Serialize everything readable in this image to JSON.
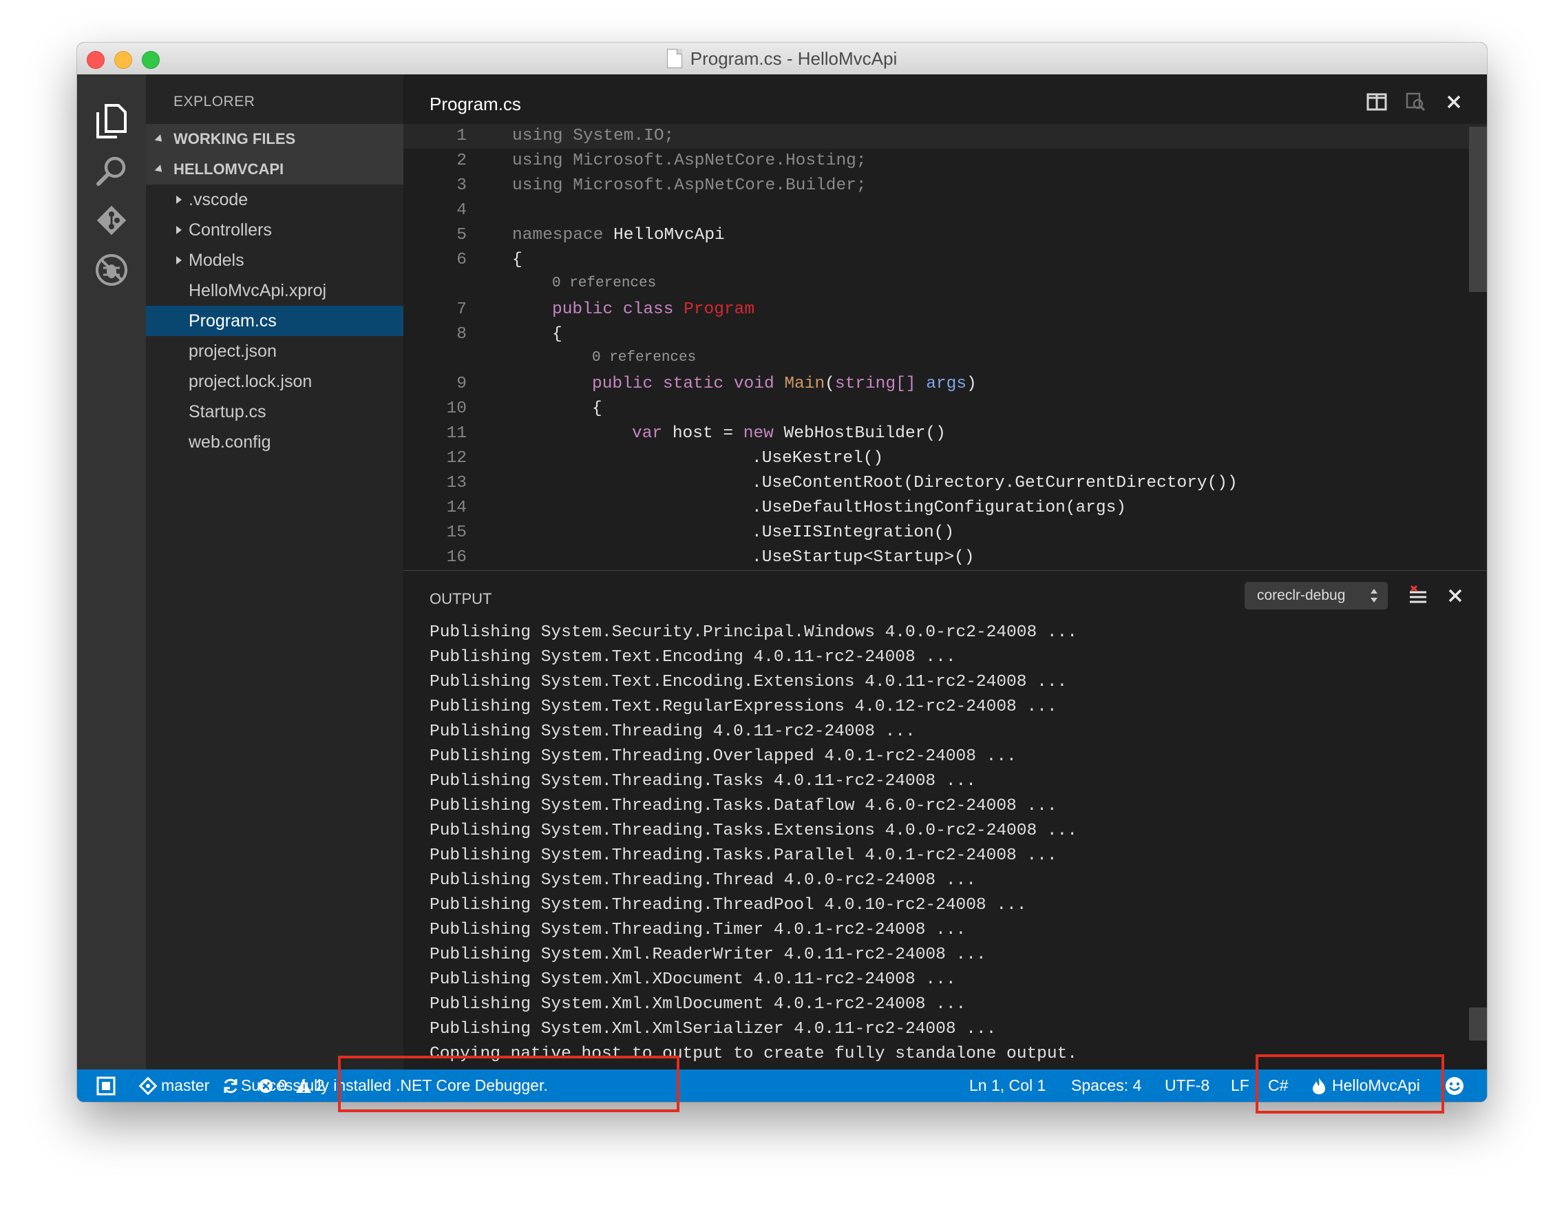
{
  "window": {
    "title": "Program.cs - HelloMvcApi"
  },
  "sidebar": {
    "title": "EXPLORER",
    "sections": [
      {
        "label": "WORKING FILES"
      },
      {
        "label": "HELLOMVCAPI"
      }
    ],
    "items": [
      {
        "label": ".vscode",
        "folder": true
      },
      {
        "label": "Controllers",
        "folder": true
      },
      {
        "label": "Models",
        "folder": true
      },
      {
        "label": "HelloMvcApi.xproj",
        "folder": false
      },
      {
        "label": "Program.cs",
        "folder": false,
        "selected": true
      },
      {
        "label": "project.json",
        "folder": false
      },
      {
        "label": "project.lock.json",
        "folder": false
      },
      {
        "label": "Startup.cs",
        "folder": false
      },
      {
        "label": "web.config",
        "folder": false
      }
    ]
  },
  "editor": {
    "tab_title": "Program.cs",
    "code_lens": [
      "0 references",
      "0 references"
    ],
    "line_numbers": [
      "1",
      "2",
      "3",
      "4",
      "5",
      "6",
      "7",
      "8",
      "9",
      "10",
      "11",
      "12",
      "13",
      "14",
      "15",
      "16"
    ],
    "code": {
      "l1": "using System.IO;",
      "l2": "using Microsoft.AspNetCore.Hosting;",
      "l3": "using Microsoft.AspNetCore.Builder;",
      "l5_kw": "namespace",
      "l5_name": "HelloMvcApi",
      "l6": "{",
      "l7_kw": "public class",
      "l7_name": "Program",
      "l8": "{",
      "l9_kw": "public static void",
      "l9_name": "Main",
      "l9_paren": "(",
      "l9_type": "string[]",
      "l9_param": "args",
      "l9_close": ")",
      "l10": "{",
      "l11_kw": "var",
      "l11_mid": "host =",
      "l11_new": "new",
      "l11_rest": "WebHostBuilder()",
      "l12": ".UseKestrel()",
      "l13": ".UseContentRoot(Directory.GetCurrentDirectory())",
      "l14": ".UseDefaultHostingConfiguration(args)",
      "l15": ".UseIISIntegration()",
      "l16": ".UseStartup<Startup>()"
    }
  },
  "panel": {
    "title": "OUTPUT",
    "channel": "coreclr-debug",
    "lines": [
      "Publishing System.Security.Principal.Windows 4.0.0-rc2-24008 ...",
      "Publishing System.Text.Encoding 4.0.11-rc2-24008 ...",
      "Publishing System.Text.Encoding.Extensions 4.0.11-rc2-24008 ...",
      "Publishing System.Text.RegularExpressions 4.0.12-rc2-24008 ...",
      "Publishing System.Threading 4.0.11-rc2-24008 ...",
      "Publishing System.Threading.Overlapped 4.0.1-rc2-24008 ...",
      "Publishing System.Threading.Tasks 4.0.11-rc2-24008 ...",
      "Publishing System.Threading.Tasks.Dataflow 4.6.0-rc2-24008 ...",
      "Publishing System.Threading.Tasks.Extensions 4.0.0-rc2-24008 ...",
      "Publishing System.Threading.Tasks.Parallel 4.0.1-rc2-24008 ...",
      "Publishing System.Threading.Thread 4.0.0-rc2-24008 ...",
      "Publishing System.Threading.ThreadPool 4.0.10-rc2-24008 ...",
      "Publishing System.Threading.Timer 4.0.1-rc2-24008 ...",
      "Publishing System.Xml.ReaderWriter 4.0.11-rc2-24008 ...",
      "Publishing System.Xml.XDocument 4.0.11-rc2-24008 ...",
      "Publishing System.Xml.XmlDocument 4.0.1-rc2-24008 ...",
      "Publishing System.Xml.XmlSerializer 4.0.11-rc2-24008 ...",
      "Copying native host to output to create fully standalone output."
    ]
  },
  "statusbar": {
    "branch": "master",
    "errors": "0",
    "warnings": "2",
    "message": "Successfully installed .NET Core Debugger.",
    "position": "Ln 1, Col 1",
    "spaces": "Spaces: 4",
    "encoding": "UTF-8",
    "eol": "LF",
    "language": "C#",
    "project": "HelloMvcApi"
  },
  "colors": {
    "statusbar": "#007acc",
    "selection": "#094771",
    "highlight_box": "#e02d1f"
  }
}
